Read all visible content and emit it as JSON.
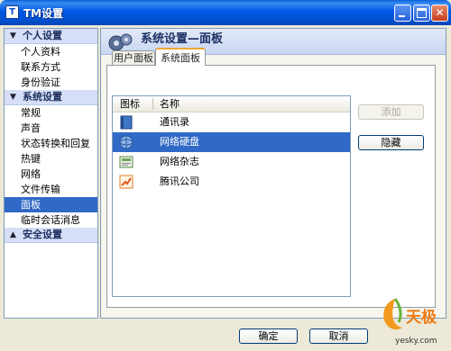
{
  "window": {
    "title": "TM设置"
  },
  "nav": {
    "sections": [
      {
        "label": "个人设置",
        "items": [
          "个人资料",
          "联系方式",
          "身份验证"
        ]
      },
      {
        "label": "系统设置",
        "items": [
          "常规",
          "声音",
          "状态转换和回复",
          "热键",
          "网络",
          "文件传输",
          "面板",
          "临时会话消息"
        ]
      },
      {
        "label": "安全设置",
        "items": []
      }
    ],
    "selected": "面板"
  },
  "main": {
    "title": "系统设置—面板",
    "tabs": [
      {
        "label": "用户面板"
      },
      {
        "label": "系统面板",
        "active": true
      }
    ],
    "list": {
      "columns": [
        "图标",
        "名称"
      ],
      "rows": [
        {
          "icon": "address-book-icon",
          "name": "通讯录"
        },
        {
          "icon": "network-disk-icon",
          "name": "网络硬盘",
          "selected": true
        },
        {
          "icon": "network-magazine-icon",
          "name": "网络杂志"
        },
        {
          "icon": "tencent-company-icon",
          "name": "腾讯公司"
        }
      ]
    },
    "buttons": {
      "add": "添加",
      "hide": "隐藏"
    }
  },
  "footer": {
    "ok": "确定",
    "cancel": "取消"
  },
  "watermark": {
    "brand": "天极",
    "site": "yesky.com"
  },
  "colors": {
    "selection": "#3169C6",
    "titlebar": "#0058E6",
    "tab_accent": "#F2A33A"
  }
}
